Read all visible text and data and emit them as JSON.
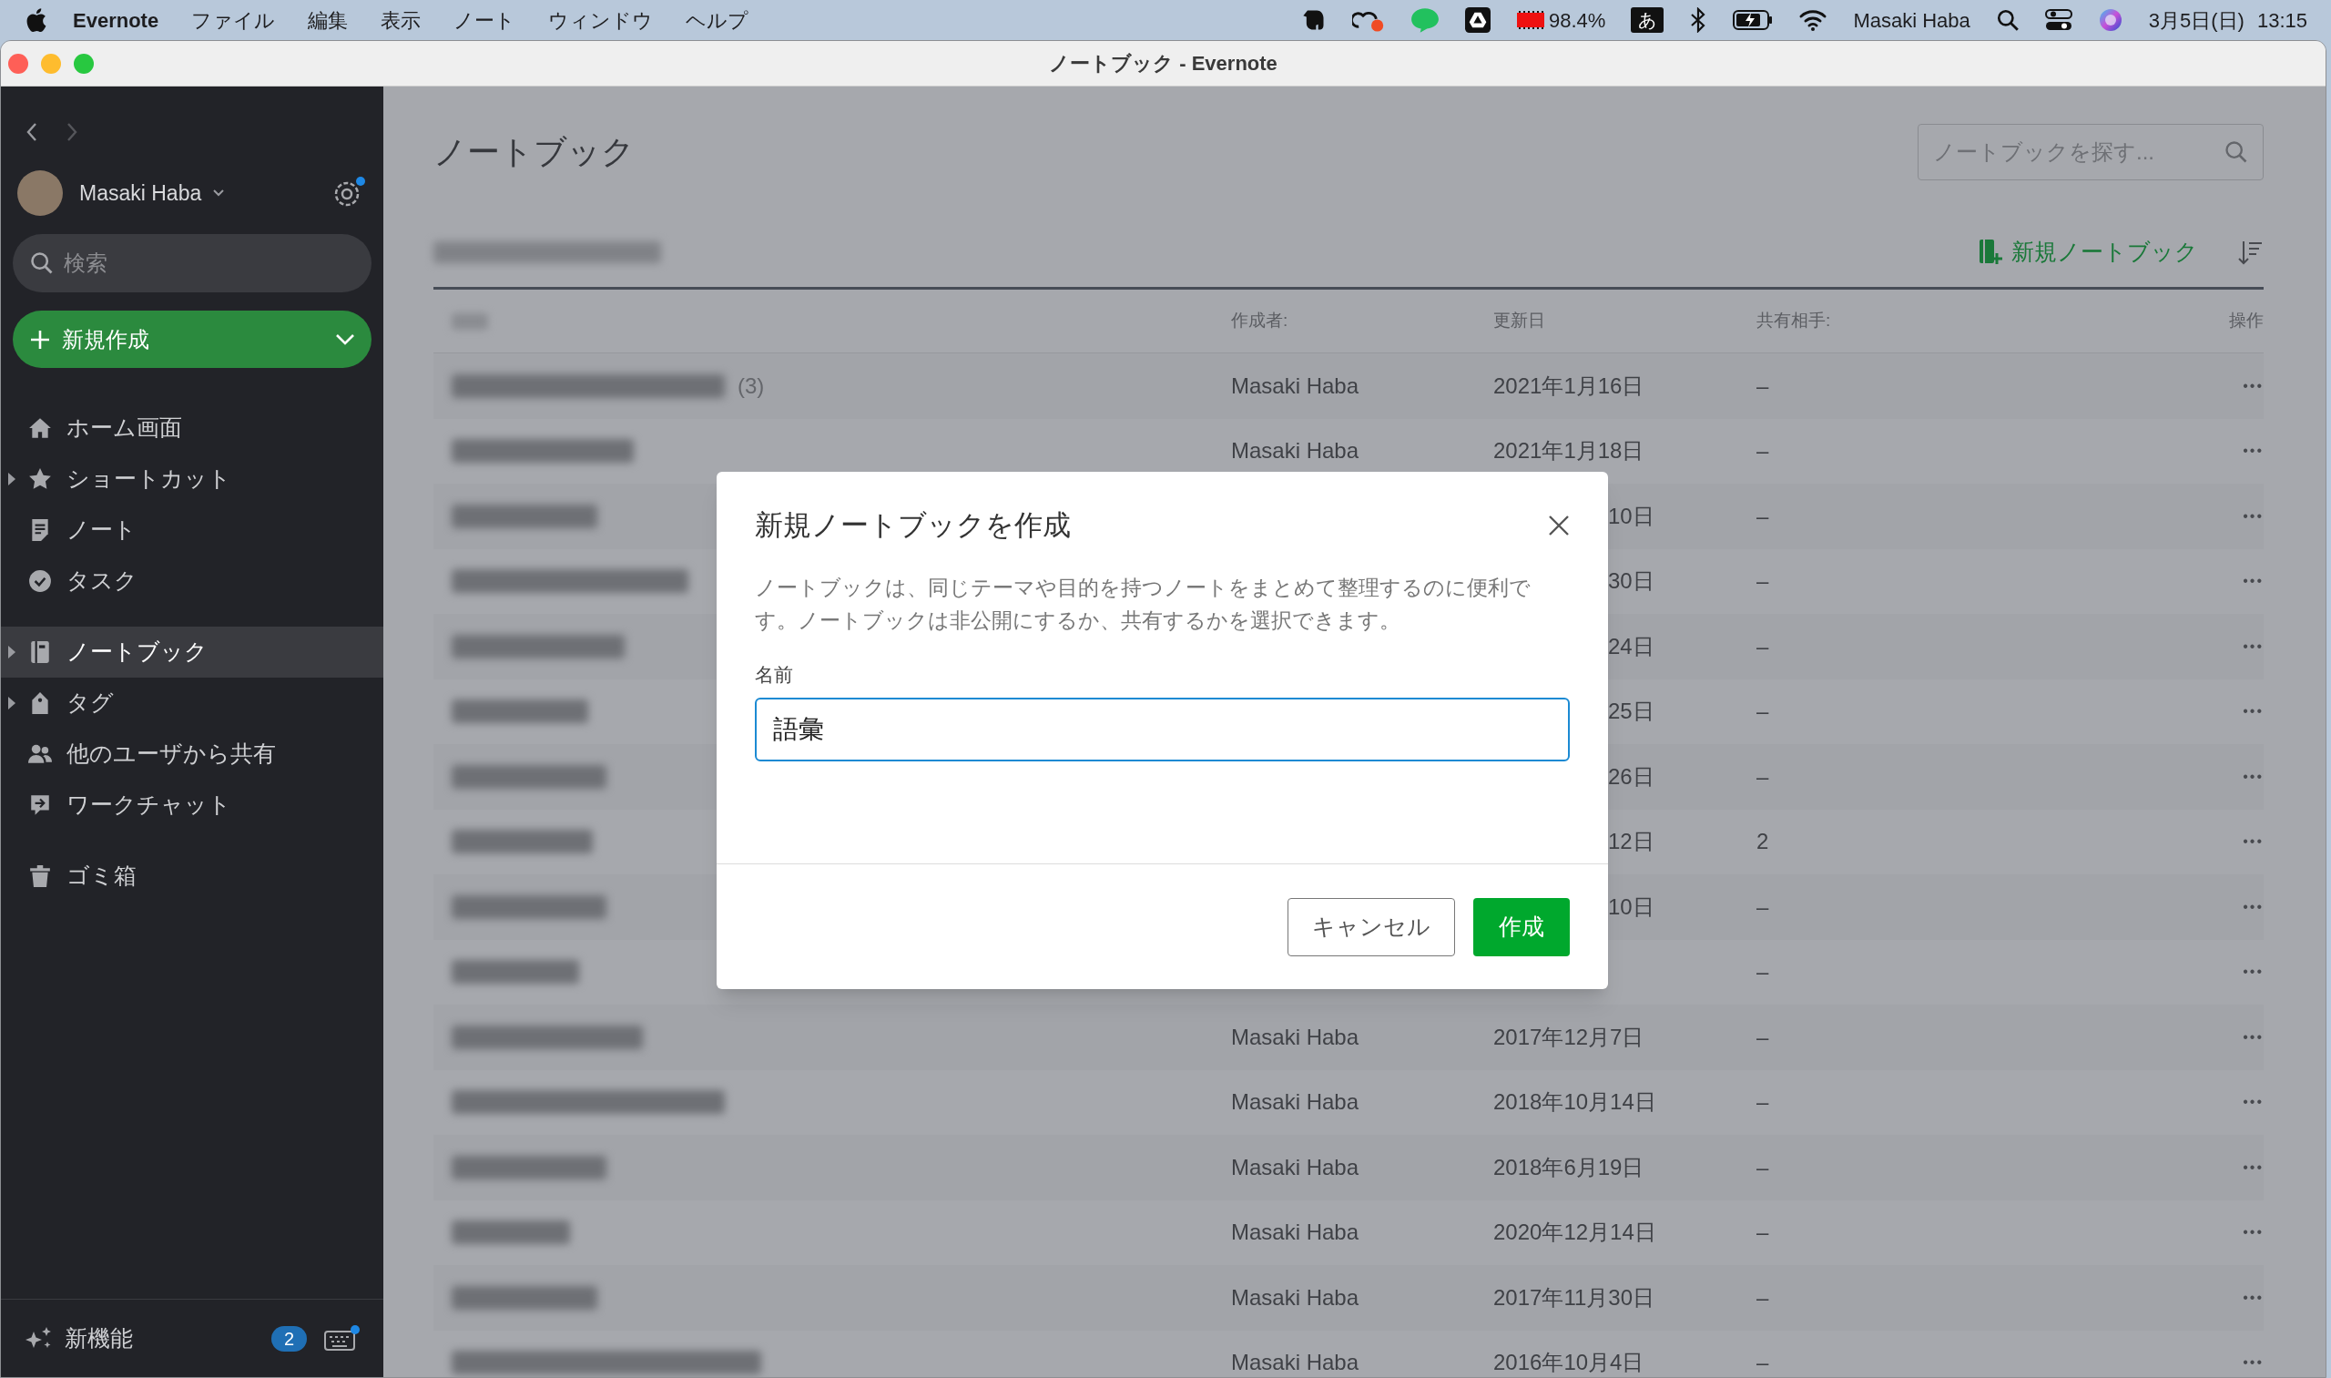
{
  "menu_bar": {
    "app": "Evernote",
    "menus": [
      "ファイル",
      "編集",
      "表示",
      "ノート",
      "ウィンドウ",
      "ヘルプ"
    ],
    "battery_level_text": "98.4%",
    "input_mode": "あ",
    "user": "Masaki Haba",
    "date": "3月5日(日)",
    "time": "13:15"
  },
  "window": {
    "title": "ノートブック - Evernote"
  },
  "sidebar": {
    "user": "Masaki Haba",
    "search": {
      "placeholder": "検索"
    },
    "new_button": "新規作成",
    "groups": [
      {
        "items": [
          {
            "label": "ホーム画面",
            "expandable": false,
            "selected": false
          },
          {
            "label": "ショートカット",
            "expandable": true,
            "selected": false
          },
          {
            "label": "ノート",
            "expandable": false,
            "selected": false
          },
          {
            "label": "タスク",
            "expandable": false,
            "selected": false
          }
        ]
      },
      {
        "items": [
          {
            "label": "ノートブック",
            "expandable": true,
            "selected": true
          },
          {
            "label": "タグ",
            "expandable": true,
            "selected": false
          },
          {
            "label": "他のユーザから共有",
            "expandable": false,
            "selected": false
          },
          {
            "label": "ワークチャット",
            "expandable": false,
            "selected": false
          }
        ]
      },
      {
        "items": [
          {
            "label": "ゴミ箱",
            "expandable": false,
            "selected": false
          }
        ]
      }
    ],
    "footer": {
      "label": "新機能",
      "badge": "2"
    }
  },
  "main": {
    "title": "ノートブック",
    "search": {
      "placeholder": "ノートブックを探す..."
    },
    "new_notebook": "新規ノートブック",
    "table": {
      "columns": [
        "作成者:",
        "更新日",
        "共有相手:",
        "操作"
      ],
      "rows": [
        {
          "count": "(3)",
          "author": "Masaki Haba",
          "updated": "2021年1月16日",
          "shared": "–",
          "action": "•••"
        },
        {
          "author": "Masaki Haba",
          "updated": "2021年1月18日",
          "shared": "–",
          "action": "•••"
        },
        {
          "updated": "10日",
          "shared": "–",
          "action": "•••"
        },
        {
          "updated": "30日",
          "shared": "–",
          "action": "•••"
        },
        {
          "updated": "24日",
          "shared": "–",
          "action": "•••"
        },
        {
          "updated": "25日",
          "shared": "–",
          "action": "•••"
        },
        {
          "updated": "26日",
          "shared": "–",
          "action": "•••"
        },
        {
          "updated": "12日",
          "shared": "2",
          "action": "•••"
        },
        {
          "updated": "10日",
          "shared": "–",
          "action": "•••"
        },
        {
          "shared": "–",
          "action": "•••"
        },
        {
          "author": "Masaki Haba",
          "updated": "2017年12月7日",
          "shared": "–",
          "action": "•••"
        },
        {
          "author": "Masaki Haba",
          "updated": "2018年10月14日",
          "shared": "–",
          "action": "•••"
        },
        {
          "author": "Masaki Haba",
          "updated": "2018年6月19日",
          "shared": "–",
          "action": "•••"
        },
        {
          "author": "Masaki Haba",
          "updated": "2020年12月14日",
          "shared": "–",
          "action": "•••"
        },
        {
          "author": "Masaki Haba",
          "updated": "2017年11月30日",
          "shared": "–",
          "action": "•••"
        },
        {
          "author": "Masaki Haba",
          "updated": "2016年10月4日",
          "shared": "–",
          "action": "•••"
        }
      ]
    }
  },
  "dialog": {
    "title": "新規ノートブックを作成",
    "description": "ノートブックは、同じテーマや目的を持つノートをまとめて整理するのに便利です。ノートブックは非公開にするか、共有するかを選択できます。",
    "name_label": "名前",
    "name_value": "語彙",
    "cancel": "キャンセル",
    "create": "作成"
  }
}
